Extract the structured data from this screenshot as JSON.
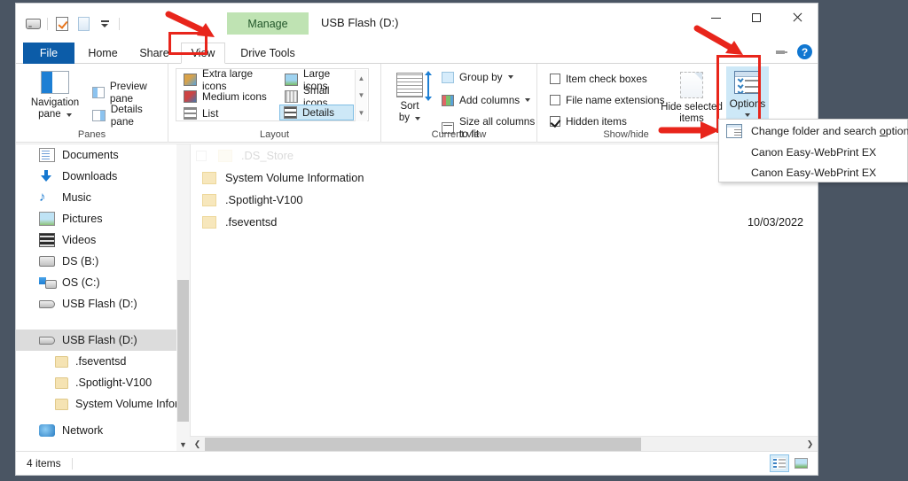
{
  "window": {
    "title": "USB Flash (D:)",
    "contextual_tab": "Manage",
    "controls": {
      "minimize": "─",
      "maximize": "□",
      "close": "✕"
    },
    "help_label": "?",
    "quick_access": [
      "drive-icon",
      "properties-icon",
      "new-folder-icon",
      "customize-caret"
    ]
  },
  "tabs": [
    {
      "label": "File",
      "name": "tab-file"
    },
    {
      "label": "Home",
      "name": "tab-home"
    },
    {
      "label": "Share",
      "name": "tab-share"
    },
    {
      "label": "View",
      "name": "tab-view"
    },
    {
      "label": "Drive Tools",
      "name": "tab-drive-tools"
    }
  ],
  "ribbon": {
    "panes": {
      "group_label": "Panes",
      "navigation_pane": "Navigation\npane",
      "navigation_pane_line1": "Navigation",
      "navigation_pane_line2": "pane",
      "preview_pane": "Preview pane",
      "details_pane": "Details pane"
    },
    "layout": {
      "group_label": "Layout",
      "items": [
        {
          "label": "Extra large icons",
          "selected": false
        },
        {
          "label": "Large icons",
          "selected": false
        },
        {
          "label": "Medium icons",
          "selected": false
        },
        {
          "label": "Small icons",
          "selected": false
        },
        {
          "label": "List",
          "selected": false
        },
        {
          "label": "Details",
          "selected": true
        }
      ]
    },
    "current_view": {
      "group_label": "Current view",
      "sort_by_line1": "Sort",
      "sort_by_line2": "by",
      "group_by": "Group by",
      "add_columns": "Add columns",
      "size_all_columns": "Size all columns to fit"
    },
    "show_hide": {
      "group_label": "Show/hide",
      "item_check_boxes": "Item check boxes",
      "item_check_boxes_on": false,
      "file_name_extensions": "File name extensions",
      "file_name_extensions_on": false,
      "hidden_items": "Hidden items",
      "hidden_items_on": true,
      "hide_selected_line1": "Hide selected",
      "hide_selected_line2": "items",
      "options": "Options"
    }
  },
  "dropdown": {
    "items": [
      {
        "label_pre": "Change folder and search ",
        "label_accel": "o",
        "label_post": "ptions",
        "highlighted": true
      },
      {
        "label": "Canon Easy-WebPrint EX",
        "highlighted": false
      },
      {
        "label": "Canon Easy-WebPrint EX",
        "highlighted": false
      }
    ]
  },
  "navigation": {
    "items": [
      {
        "label": "Documents",
        "icon": "documents-icon",
        "indent": 0,
        "selected": false
      },
      {
        "label": "Downloads",
        "icon": "downloads-icon",
        "indent": 0,
        "selected": false
      },
      {
        "label": "Music",
        "icon": "music-icon",
        "indent": 0,
        "selected": false
      },
      {
        "label": "Pictures",
        "icon": "pictures-icon",
        "indent": 0,
        "selected": false
      },
      {
        "label": "Videos",
        "icon": "videos-icon",
        "indent": 0,
        "selected": false
      },
      {
        "label": "DS (B:)",
        "icon": "drive-icon",
        "indent": 0,
        "selected": false
      },
      {
        "label": "OS (C:)",
        "icon": "os-drive-icon",
        "indent": 0,
        "selected": false
      },
      {
        "label": "USB Flash (D:)",
        "icon": "usb-drive-icon",
        "indent": 0,
        "selected": false
      },
      {
        "label": "USB Flash (D:)",
        "icon": "usb-drive-icon",
        "indent": 0,
        "selected": true
      },
      {
        "label": ".fseventsd",
        "icon": "folder-icon",
        "indent": 1,
        "selected": false
      },
      {
        "label": ".Spotlight-V100",
        "icon": "folder-icon",
        "indent": 1,
        "selected": false
      },
      {
        "label": "System Volume Inform",
        "icon": "folder-icon",
        "indent": 1,
        "selected": false
      },
      {
        "label": "Network",
        "icon": "network-icon",
        "indent": 0,
        "selected": false
      }
    ]
  },
  "file_list": {
    "rows": [
      {
        "name": ".DS_Store",
        "date": "",
        "ghost": true
      },
      {
        "name": "System Volume Information",
        "date": "",
        "ghost": false
      },
      {
        "name": ".Spotlight-V100",
        "date": "",
        "ghost": false
      },
      {
        "name": ".fseventsd",
        "date": "10/03/2022 ",
        "ghost": false
      }
    ]
  },
  "status_bar": {
    "item_count": "4 items",
    "view_details": "details-view-icon",
    "view_large": "large-icons-view-icon"
  },
  "colors": {
    "accent": "#0c5ca8",
    "highlight_red": "#e8251b",
    "selection_blue": "#cde8f7",
    "contextual_green": "#bfe3b3",
    "desktop": "#4a5563"
  }
}
